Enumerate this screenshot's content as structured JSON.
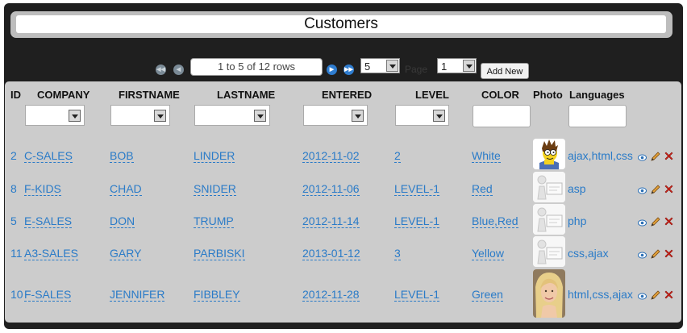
{
  "title": "Customers",
  "pager": {
    "rows_info": "1 to 5 of 12 rows",
    "page_size": "5",
    "page_label": "Page",
    "page": "1",
    "add_new": "Add New"
  },
  "headers": {
    "id": "ID",
    "company": "COMPANY",
    "firstname": "FIRSTNAME",
    "lastname": "LASTNAME",
    "entered": "ENTERED",
    "level": "LEVEL",
    "color": "COLOR",
    "photo": "Photo",
    "languages": "Languages"
  },
  "rows": [
    {
      "id": "2",
      "company": "C-SALES",
      "firstname": "BOB",
      "lastname": "LINDER",
      "entered": "2012-11-02",
      "level": "2",
      "color": "White",
      "photo": "cartoon-avatar",
      "languages": "ajax,html,css"
    },
    {
      "id": "8",
      "company": "F-KIDS",
      "firstname": "CHAD",
      "lastname": "SNIDER",
      "entered": "2012-11-06",
      "level": "LEVEL-1",
      "color": "Red",
      "photo": "placeholder-avatar",
      "languages": "asp"
    },
    {
      "id": "5",
      "company": "E-SALES",
      "firstname": "DON",
      "lastname": "TRUMP",
      "entered": "2012-11-14",
      "level": "LEVEL-1",
      "color": "Blue,Red",
      "photo": "placeholder-avatar",
      "languages": "php"
    },
    {
      "id": "11",
      "company": "A3-SALES",
      "firstname": "GARY",
      "lastname": "PARBISKI",
      "entered": "2013-01-12",
      "level": "3",
      "color": "Yellow",
      "photo": "placeholder-avatar",
      "languages": "css,ajax"
    },
    {
      "id": "10",
      "company": "F-SALES",
      "firstname": "JENNIFER",
      "lastname": "FIBBLEY",
      "entered": "2012-11-28",
      "level": "LEVEL-1",
      "color": "Green",
      "photo": "portrait-photo",
      "languages": "html,css,ajax"
    }
  ],
  "colors": {
    "link": "#2a7bc8",
    "panel": "#cccccc",
    "frame": "#1f1f1f",
    "delete": "#d9261c"
  }
}
